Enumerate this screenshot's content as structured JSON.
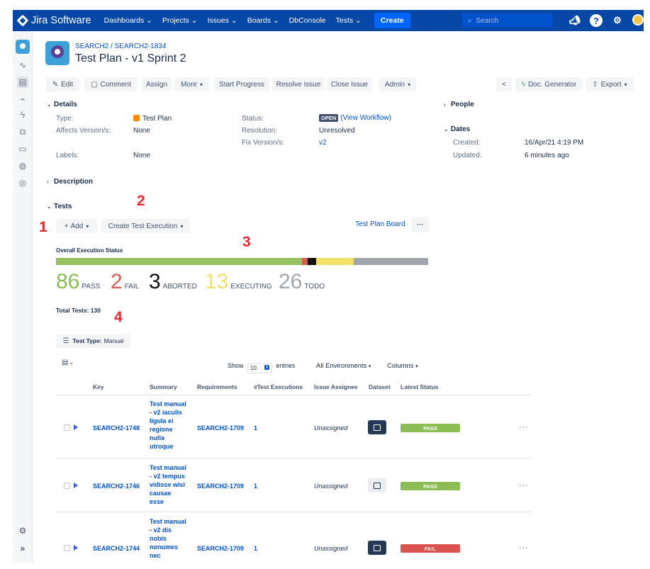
{
  "topbar": {
    "app_name": "Jira Software",
    "nav": [
      "Dashboards ⌄",
      "Projects ⌄",
      "Issues ⌄",
      "Boards ⌄",
      "DbConsole",
      "Tests ⌄"
    ],
    "create_label": "Create",
    "search_placeholder": "Search"
  },
  "header": {
    "breadcrumb_project": "SEARCH2",
    "breadcrumb_sep": " / ",
    "breadcrumb_issue": "SEARCH2-1834",
    "title": "Test Plan - v1 Sprint 2"
  },
  "toolbar": {
    "edit": "Edit",
    "comment": "Comment",
    "assign": "Assign",
    "more": "More",
    "start_progress": "Start Progress",
    "resolve": "Resolve Issue",
    "close": "Close Issue",
    "admin": "Admin",
    "doc_generator": "Doc. Generator",
    "export": "Export"
  },
  "details": {
    "section": "Details",
    "type_label": "Type:",
    "type_value": "Test Plan",
    "affects_label": "Affects Version/s:",
    "affects_value": "None",
    "labels_label": "Labels:",
    "labels_value": "None",
    "status_label": "Status:",
    "status_badge": "OPEN",
    "status_link": "(View Workflow)",
    "resolution_label": "Resolution:",
    "resolution_value": "Unresolved",
    "fix_label": "Fix Version/s:",
    "fix_value": "v2"
  },
  "people": {
    "section": "People"
  },
  "dates": {
    "section": "Dates",
    "created_label": "Created:",
    "created_value": "16/Apr/21 4:19 PM",
    "updated_label": "Updated:",
    "updated_value": "6 minutes ago"
  },
  "description": {
    "section": "Description"
  },
  "tests": {
    "section": "Tests",
    "add": "Add",
    "create_exec": "Create Test Execution",
    "board": "Test Plan Board",
    "overall": "Overall Execution Status",
    "total": "Total Tests: 130",
    "filter_label": "Test Type:",
    "filter_value": "Manual",
    "show": "Show",
    "entries_count": "10",
    "entries": "entries",
    "environments": "All Environments",
    "columns": "Columns"
  },
  "execution": {
    "pass": 86,
    "pass_label": "PASS",
    "fail": 2,
    "fail_label": "FAIL",
    "aborted": 3,
    "aborted_label": "ABORTED",
    "executing": 13,
    "executing_label": "EXECUTING",
    "todo": 26,
    "todo_label": "TODO",
    "total": 130,
    "colors": {
      "pass": "#95c160",
      "fail": "#d45d52",
      "aborted": "#111111",
      "executing": "#f1e069",
      "todo": "#a2a6ae"
    }
  },
  "annotations": [
    "1",
    "2",
    "3",
    "4"
  ],
  "table": {
    "headers": [
      "Key",
      "Summary",
      "Requirements",
      "#Test Executions",
      "Issue Assignee",
      "Dataset",
      "Latest Status"
    ],
    "rows": [
      {
        "key": "SEARCH2-1748",
        "summary": [
          "Test manual",
          "- v2 iaculis",
          "ligula ei",
          "regione",
          "nulla",
          "utroque"
        ],
        "req": "SEARCH2-1709",
        "execs": "1",
        "assignee": "Unassigned",
        "status": "PASS",
        "status_color": "#8bbd54"
      },
      {
        "key": "SEARCH2-1746",
        "summary": [
          "Test manual",
          "- v2 tempus",
          "vidisse wisi",
          "causae",
          "esse"
        ],
        "req": "SEARCH2-1709",
        "execs": "1",
        "assignee": "Unassigned",
        "status": "PASS",
        "status_color": "#8bbd54"
      },
      {
        "key": "SEARCH2-1744",
        "summary": [
          "Test manual",
          "- v2 dis",
          "nobis",
          "nonumes",
          "nec"
        ],
        "req": "SEARCH2-1709",
        "execs": "1",
        "assignee": "Unassigned",
        "status": "FAIL",
        "status_color": "#d9534f"
      }
    ]
  }
}
